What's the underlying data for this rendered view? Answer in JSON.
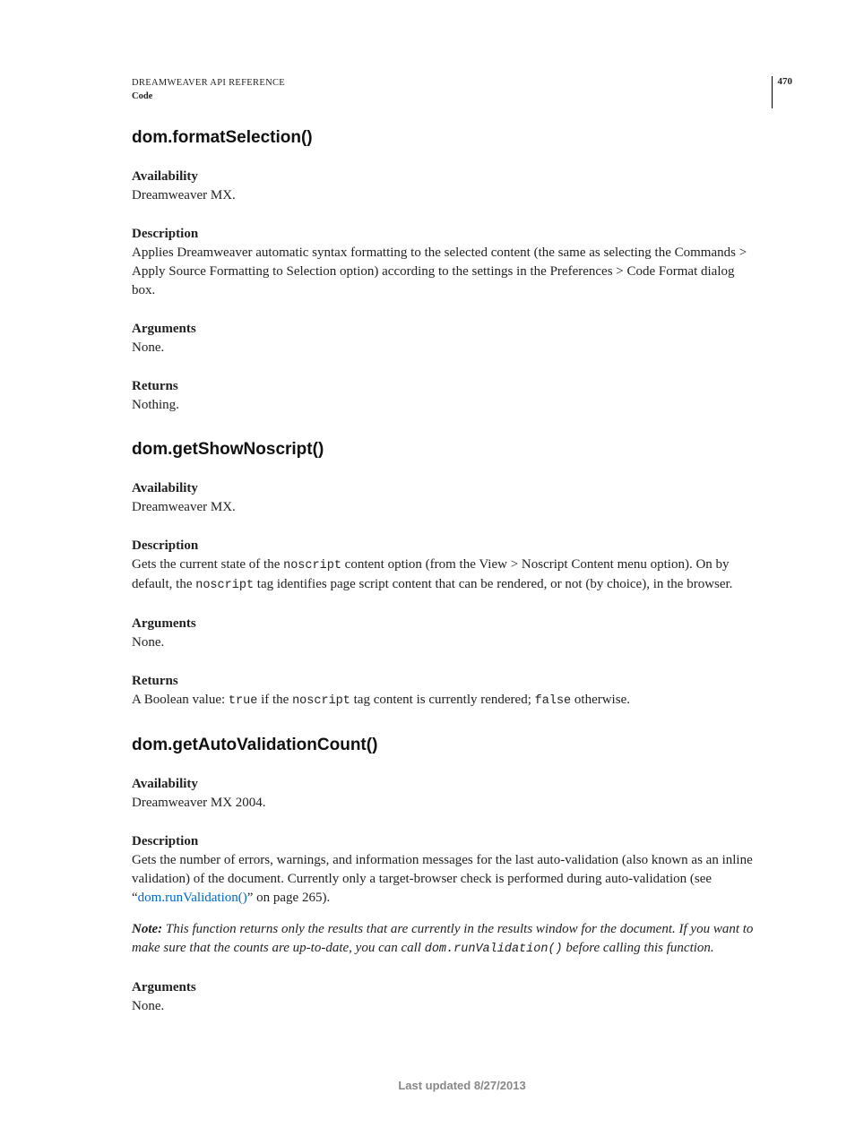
{
  "header": {
    "title": "DREAMWEAVER API REFERENCE",
    "subtitle": "Code",
    "page_number": "470"
  },
  "sections": [
    {
      "heading": "dom.formatSelection()",
      "availability_label": "Availability",
      "availability": "Dreamweaver MX.",
      "description_label": "Description",
      "description": "Applies Dreamweaver automatic syntax formatting to the selected content (the same as selecting the Commands > Apply Source Formatting to Selection option) according to the settings in the Preferences > Code Format dialog box.",
      "arguments_label": "Arguments",
      "arguments": "None.",
      "returns_label": "Returns",
      "returns": "Nothing."
    },
    {
      "heading": "dom.getShowNoscript()",
      "availability_label": "Availability",
      "availability": "Dreamweaver MX.",
      "description_label": "Description",
      "description_parts": {
        "pre1": "Gets the current state of the ",
        "code1": "noscript",
        "mid1": " content option (from the View > Noscript Content menu option). On by default, the ",
        "code2": "noscript",
        "post1": " tag identifies page script content that can be rendered, or not (by choice), in the browser."
      },
      "arguments_label": "Arguments",
      "arguments": "None.",
      "returns_label": "Returns",
      "returns_parts": {
        "pre1": "A Boolean value: ",
        "code1": "true",
        "mid1": " if the ",
        "code2": "noscript",
        "mid2": " tag content is currently rendered; ",
        "code3": "false",
        "post1": " otherwise."
      }
    },
    {
      "heading": "dom.getAutoValidationCount()",
      "availability_label": "Availability",
      "availability": "Dreamweaver MX 2004.",
      "description_label": "Description",
      "description_parts": {
        "pre1": "Gets the number of errors, warnings, and information messages for the last auto-validation (also known as an inline validation) of the document. Currently only a target-browser check is performed during auto-validation (see “",
        "link_text": "dom.runValidation()",
        "post_link": "” on page 265)."
      },
      "note_label": "Note: ",
      "note_parts": {
        "pre1": "This function returns only the results that are currently in the results window for the document. If you want to make sure that the counts are up-to-date, you can call ",
        "code1": "dom.runValidation()",
        "post1": " before calling this function."
      },
      "arguments_label": "Arguments",
      "arguments": "None."
    }
  ],
  "footer": "Last updated 8/27/2013"
}
